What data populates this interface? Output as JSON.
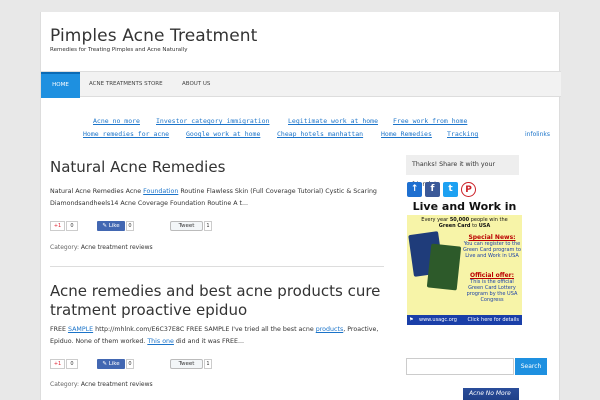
{
  "site": {
    "title": "Pimples Acne Treatment",
    "description": "Remedies for Treating Pimples and Acne Naturally"
  },
  "nav": {
    "items": [
      {
        "label": "Home",
        "active": true
      },
      {
        "label": "Acne Treatments Store",
        "active": false
      },
      {
        "label": "About Us",
        "active": false
      }
    ]
  },
  "ad_links": {
    "row1": [
      "Acne no more",
      "Investor category immigration",
      "Legitimate work at home",
      "Free work from home"
    ],
    "row2": [
      "Home remedies for acne",
      "Google work at home",
      "Cheap hotels manhattan",
      "Home Remedies",
      "Tracking"
    ],
    "brand": "infolinks"
  },
  "posts": [
    {
      "title": "Natural Acne Remedies",
      "excerpt_pre": "Natural Acne Remedies Acne ",
      "excerpt_link": "Foundation",
      "excerpt_post": " Routine Flawless Skin (Full Coverage Tutorial) Cystic & Scaring Diamondsandheels14 Acne Coverage Foundation Routine A t...",
      "gplus_label": "+1",
      "gplus_count": "0",
      "fb_label": "Like",
      "fb_count": "0",
      "tweet_label": "Tweet",
      "tweet_count": "1",
      "category_label": "Category:",
      "category": "Acne treatment reviews"
    },
    {
      "title_line1": "Acne remedies and best acne products cure",
      "title_line2": "tratment proactive epiduo",
      "excerpt_a": "FREE ",
      "excerpt_link1": "SAMPLE",
      "excerpt_b": " http://mhlnk.com/E6C37E8C FREE SAMPLE I've tried all the best acne ",
      "excerpt_link2": "products",
      "excerpt_c": ", Proactive, Epiduo. None of them worked. ",
      "excerpt_link3": "This one",
      "excerpt_d": " did and it was FREE...",
      "gplus_label": "+1",
      "gplus_count": "0",
      "fb_label": "Like",
      "fb_count": "0",
      "tweet_label": "Tweet",
      "tweet_count": "1",
      "category_label": "Category:",
      "category": "Acne treatment reviews"
    }
  ],
  "sidebar": {
    "share_text": "Thanks! Share it with your friends!",
    "social_icons": [
      "share-icon",
      "facebook-icon",
      "twitter-icon",
      "pinterest-icon"
    ],
    "ad": {
      "headline": "Live and Work in USA",
      "line1a": "Every year ",
      "line1b": "50,000",
      "line1c": " people win the",
      "line2a": "Green Card",
      "line2b": " to ",
      "line2c": "USA",
      "special_head": "Special News:",
      "special_body": "You can register to the Green Card program to Live and Work in USA",
      "offer_head": "Official offer:",
      "offer_body": "This is the official Green Card Lottery program by the USA Congress",
      "footer_url": "www.usagc.org",
      "footer_cta": "Click here for details"
    },
    "search_button": "Search",
    "search_placeholder": "",
    "book_title": "Acne No More"
  },
  "colors": {
    "accent": "#1e90e0",
    "link": "#1a73c9",
    "facebook": "#4267b2",
    "twitter": "#1da1f2",
    "pinterest": "#cb2027"
  }
}
